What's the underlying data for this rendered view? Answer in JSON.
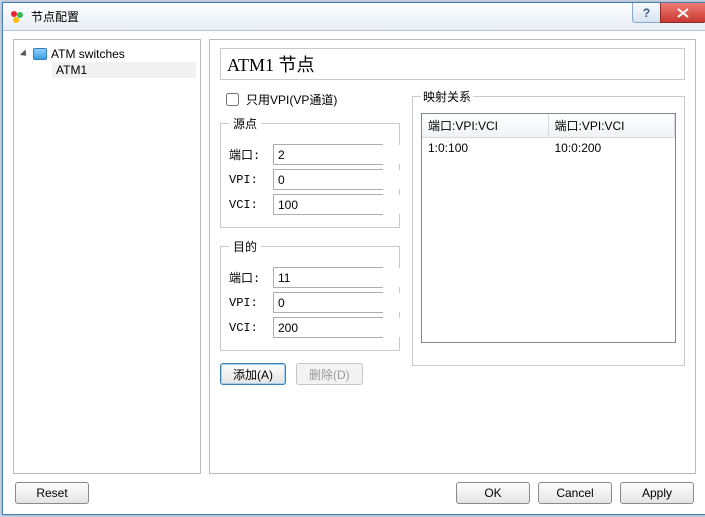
{
  "window": {
    "title": "节点配置"
  },
  "tree": {
    "root_label": "ATM switches",
    "child_label": "ATM1"
  },
  "node_title": "ATM1 节点",
  "checkbox": {
    "label": "只用VPI(VP通道)",
    "checked": false
  },
  "groups": {
    "source_legend": "源点",
    "dest_legend": "目的",
    "map_legend": "映射关系"
  },
  "fields": {
    "port_label": "端口:",
    "vpi_label": "VPI:",
    "vci_label": "VCI:",
    "source": {
      "port": "2",
      "vpi": "0",
      "vci": "100"
    },
    "dest": {
      "port": "11",
      "vpi": "0",
      "vci": "200"
    }
  },
  "buttons": {
    "add": "添加(A)",
    "delete": "删除(D)",
    "reset": "Reset",
    "ok": "OK",
    "cancel": "Cancel",
    "apply": "Apply"
  },
  "table": {
    "col1": "端口:VPI:VCI",
    "col2": "端口:VPI:VCI",
    "rows": [
      {
        "c1": "1:0:100",
        "c2": "10:0:200"
      }
    ]
  }
}
